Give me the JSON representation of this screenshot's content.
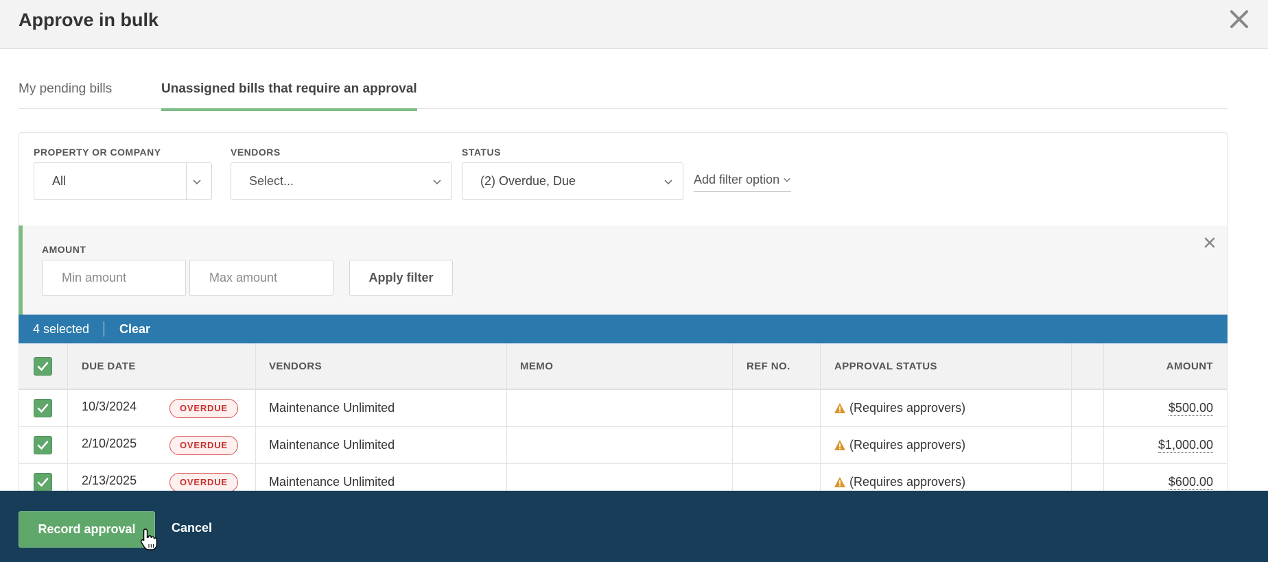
{
  "modal": {
    "title": "Approve in bulk"
  },
  "tabs": [
    {
      "label": "My pending bills",
      "active": false
    },
    {
      "label": "Unassigned bills that require an approval",
      "active": true
    }
  ],
  "filters": {
    "property": {
      "label": "PROPERTY OR COMPANY",
      "value": "All"
    },
    "vendors": {
      "label": "VENDORS",
      "value": "Select..."
    },
    "status": {
      "label": "STATUS",
      "value": "(2) Overdue, Due"
    },
    "add_filter_label": "Add filter option"
  },
  "amount_filter": {
    "label": "AMOUNT",
    "min_placeholder": "Min amount",
    "max_placeholder": "Max amount",
    "apply_label": "Apply filter"
  },
  "selection": {
    "count_text": "4 selected",
    "clear_label": "Clear"
  },
  "table": {
    "columns": [
      "DUE DATE",
      "VENDORS",
      "MEMO",
      "REF NO.",
      "APPROVAL STATUS",
      "AMOUNT"
    ],
    "rows": [
      {
        "checked": true,
        "due_date": "10/3/2024",
        "badge": "OVERDUE",
        "vendor": "Maintenance Unlimited",
        "memo": "",
        "ref_no": "",
        "approval_status": "(Requires approvers)",
        "amount": "$500.00"
      },
      {
        "checked": true,
        "due_date": "2/10/2025",
        "badge": "OVERDUE",
        "vendor": "Maintenance Unlimited",
        "memo": "",
        "ref_no": "",
        "approval_status": "(Requires approvers)",
        "amount": "$1,000.00"
      },
      {
        "checked": true,
        "due_date": "2/13/2025",
        "badge": "OVERDUE",
        "vendor": "Maintenance Unlimited",
        "memo": "",
        "ref_no": "",
        "approval_status": "(Requires approvers)",
        "amount": "$600.00"
      }
    ]
  },
  "footer": {
    "record_label": "Record approval",
    "cancel_label": "Cancel"
  },
  "colors": {
    "accent_green": "#5fa76a",
    "selection_blue": "#2b79ad",
    "footer_navy": "#173d58",
    "overdue_red": "#c9302c",
    "warning_amber": "#d9952a"
  }
}
